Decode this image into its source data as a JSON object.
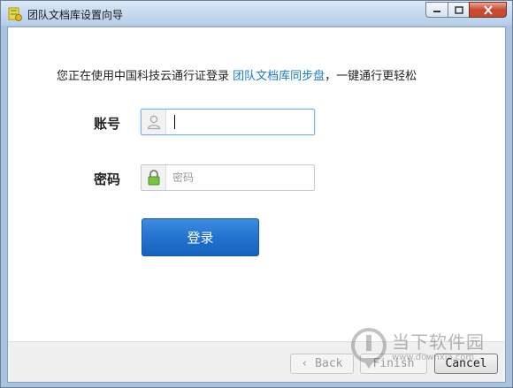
{
  "window": {
    "title": "团队文档库设置向导",
    "colors": {
      "accent": "#1a7cc2",
      "button": "#2273cf",
      "close": "#c74a33"
    }
  },
  "intro": {
    "prefix": "您正在使用中国科技云通行证登录 ",
    "link": "团队文档库同步盘",
    "suffix": "，一键通行更轻松"
  },
  "form": {
    "account_label": "账号",
    "account_value": "",
    "account_icon": "user-icon",
    "password_label": "密码",
    "password_placeholder": "密码",
    "password_icon": "lock-icon",
    "login_label": "登录"
  },
  "footer": {
    "back_label": "‹ Back",
    "finish_label": "Finish",
    "cancel_label": "Cancel"
  },
  "watermark": {
    "text": "当下软件园",
    "sub": "www.downxia.com"
  }
}
